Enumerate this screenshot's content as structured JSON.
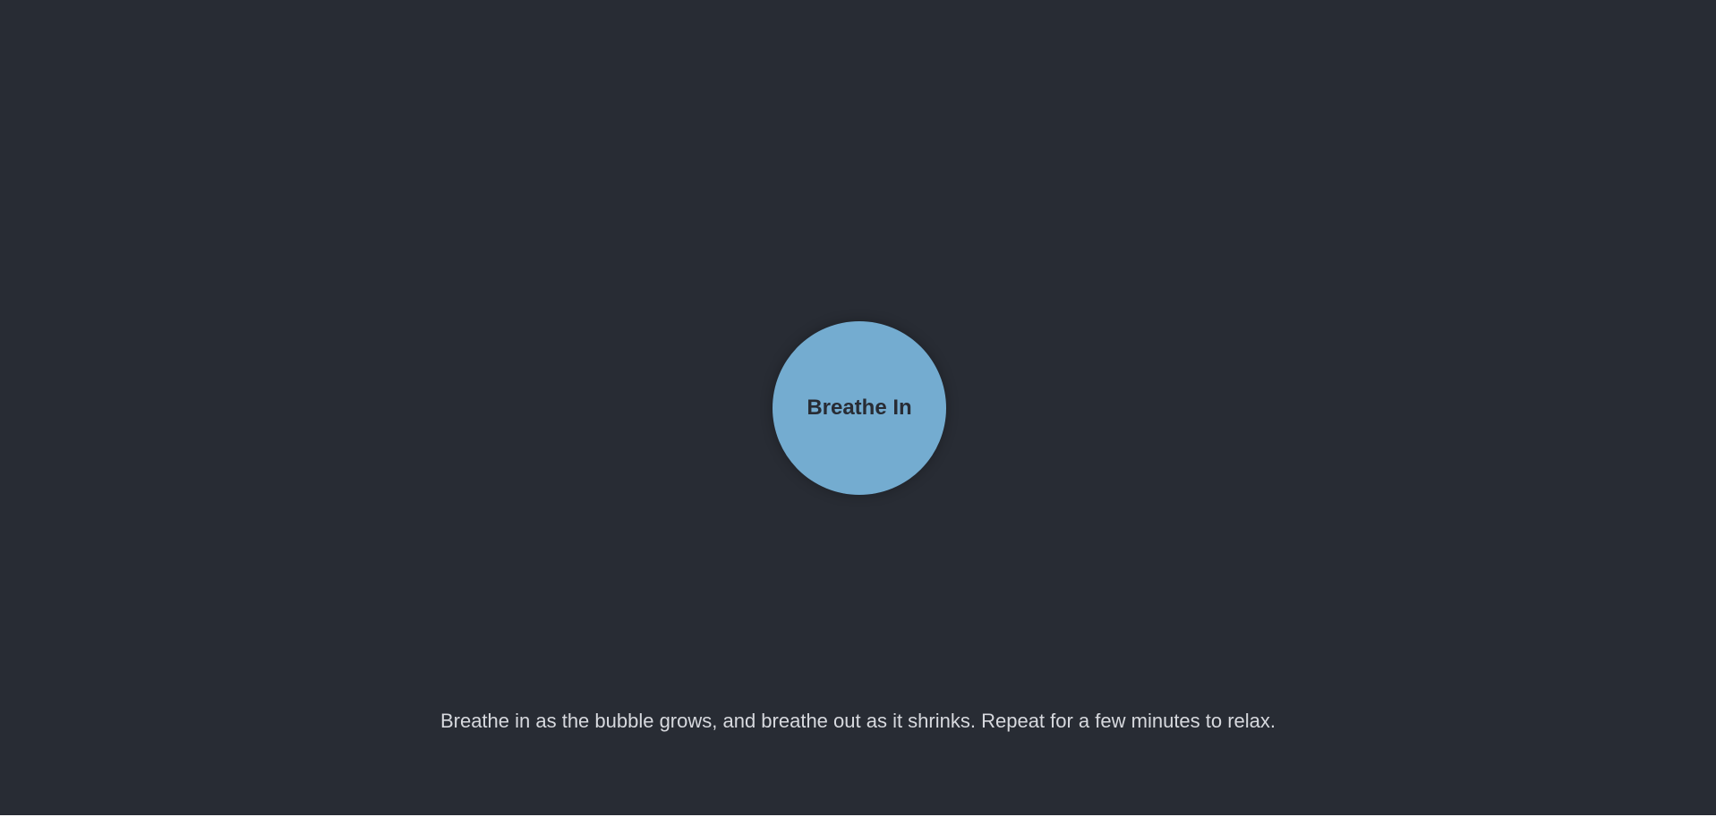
{
  "bubble": {
    "label": "Breathe In",
    "color": "#74acd0"
  },
  "instructions": {
    "text": "Breathe in as the bubble grows, and breathe out as it shrinks. Repeat for a few minutes to relax."
  },
  "theme": {
    "background": "#282c34",
    "text_color": "#d7d9de",
    "label_color": "#282c34"
  }
}
